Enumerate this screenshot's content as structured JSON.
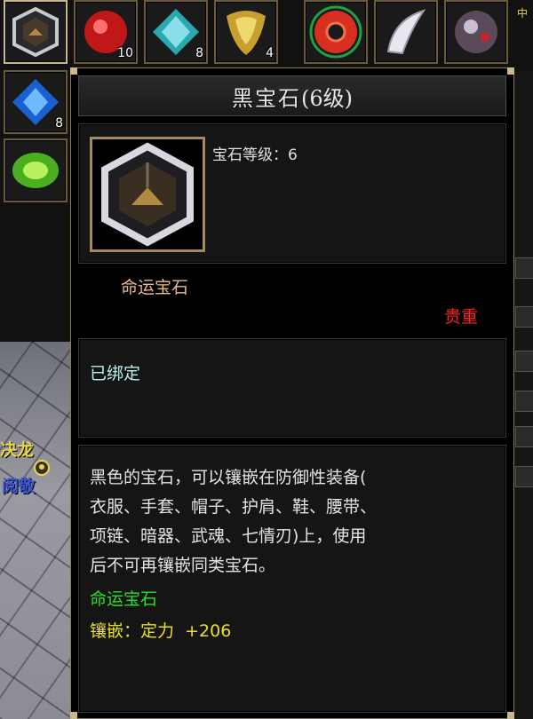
{
  "inventory": {
    "slots": [
      {
        "name": "black-gem-slot",
        "qty": ""
      },
      {
        "name": "red-gem-slot",
        "qty": "10"
      },
      {
        "name": "teal-gem-slot",
        "qty": "8"
      },
      {
        "name": "yellow-gem-slot",
        "qty": "4"
      },
      {
        "name": "jade-ring-slot",
        "qty": ""
      },
      {
        "name": "white-tooth-slot",
        "qty": ""
      },
      {
        "name": "grey-gem-slot",
        "qty": ""
      },
      {
        "name": "blue-gem-slot",
        "qty": "8"
      },
      {
        "name": "green-gem-slot",
        "qty": ""
      }
    ]
  },
  "tooltip": {
    "title": "黑宝石",
    "title_level": "(6级)",
    "gem_level_label": "宝石等级：",
    "gem_level_value": "6",
    "fate_label": "命运宝石",
    "precious": "贵重",
    "bound_status": "已绑定",
    "description": [
      "黑色的宝石，可以镶嵌在防御性装备(",
      "衣服、手套、帽子、护肩、鞋、腰带、",
      "项链、暗器、武魂、七情刃)上，使用",
      "后不可再镶嵌同类宝石。"
    ],
    "fate_line": "命运宝石",
    "inlay_label": "镶嵌：定力",
    "inlay_value": "+206"
  },
  "scene": {
    "text_top": "决龙",
    "text_bottom": "阅敬",
    "edge_label": "中"
  },
  "colors": {
    "frame_gold": "#a28a5a",
    "precious_red": "#ff2020",
    "bound_cyan": "#b8f0f0",
    "fate_orange": "#e8b890",
    "fate_green": "#28e028",
    "inlay_yellow": "#e8e020"
  }
}
